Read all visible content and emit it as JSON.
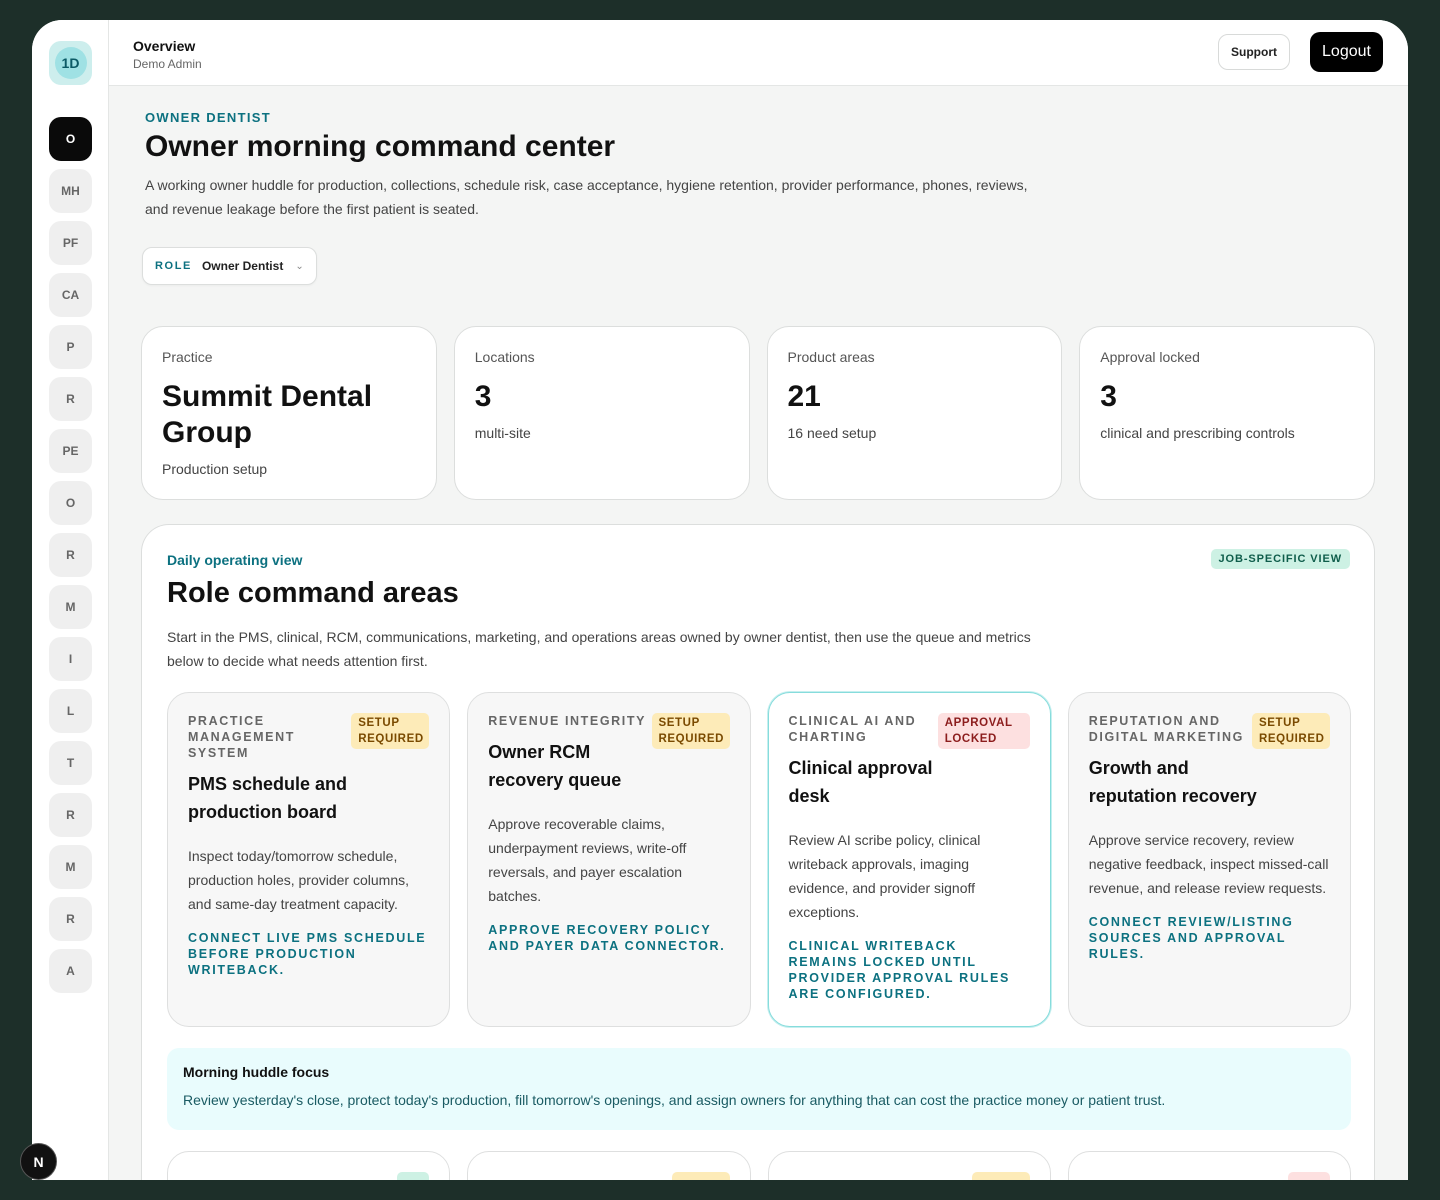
{
  "brand": {
    "initials": "1D"
  },
  "nav": [
    "O",
    "MH",
    "PF",
    "CA",
    "P",
    "R",
    "PE",
    "O",
    "R",
    "M",
    "I",
    "L",
    "T",
    "R",
    "M",
    "R",
    "A"
  ],
  "topbar": {
    "title": "Overview",
    "subtitle": "Demo Admin",
    "support_label": "Support",
    "logout_label": "Logout"
  },
  "hero": {
    "eyebrow": "OWNER DENTIST",
    "title": "Owner morning command center",
    "lede": "A working owner huddle for production, collections, schedule risk, case acceptance, hygiene retention, provider performance, phones, reviews, and revenue leakage before the first patient is seated.",
    "role": {
      "label": "ROLE",
      "value": "Owner Dentist"
    }
  },
  "stats": [
    {
      "label": "Practice",
      "value": "Summit Dental Group",
      "note": "Production setup"
    },
    {
      "label": "Locations",
      "value": "3",
      "note": "multi-site"
    },
    {
      "label": "Product areas",
      "value": "21",
      "note": "16 need setup"
    },
    {
      "label": "Approval locked",
      "value": "3",
      "note": "clinical and prescribing controls"
    }
  ],
  "panel": {
    "eyebrow": "Daily operating view",
    "badge": "JOB-SPECIFIC VIEW",
    "title": "Role command areas",
    "lede": "Start in the PMS, clinical, RCM, communications, marketing, and operations areas owned by owner dentist, then use the queue and metrics below to decide what needs attention first.",
    "cards": [
      {
        "area": "Practice management system",
        "badge": "Setup required",
        "title": "PMS schedule and production board",
        "desc": "Inspect today/tomorrow schedule, production holes, provider columns, and same-day treatment capacity.",
        "cta": "Connect live PMS schedule before production writeback."
      },
      {
        "area": "Revenue integrity",
        "badge": "Setup required",
        "title": "Owner RCM recovery queue",
        "desc": "Approve recoverable claims, underpayment reviews, write-off reversals, and payer escalation batches.",
        "cta": "Approve recovery policy and payer data connector."
      },
      {
        "area": "Clinical AI and charting",
        "badge": "Approval locked",
        "title": "Clinical approval desk",
        "desc": "Review AI scribe policy, clinical writeback approvals, imaging evidence, and provider signoff exceptions.",
        "cta": "Clinical writeback remains locked until provider approval rules are configured."
      },
      {
        "area": "Reputation and digital marketing",
        "badge": "Setup required",
        "title": "Growth and reputation recovery",
        "desc": "Approve service recovery, review negative feedback, inspect missed-call revenue, and release review requests.",
        "cta": "Connect review/listing sources and approval rules."
      }
    ],
    "focus": {
      "title": "Morning huddle focus",
      "text": "Review yesterday's close, protect today's production, fill tomorrow's openings, and assign owners for anything that can cost the practice money or patient trust."
    }
  },
  "colors": {
    "accent": "#0c7180",
    "setup": "#fdebb8",
    "locked": "#fde0e0",
    "ok": "#cdf1e4"
  },
  "dev_badge": "N"
}
